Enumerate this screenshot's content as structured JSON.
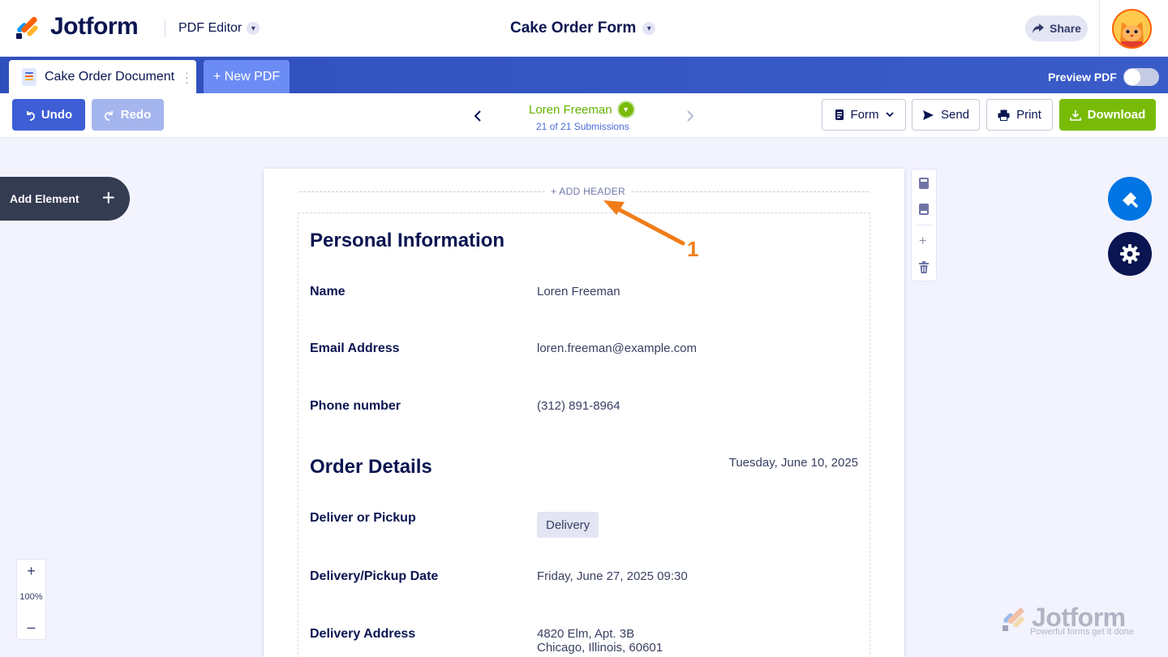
{
  "header": {
    "brand": "Jotform",
    "app_name": "PDF Editor",
    "form_title": "Cake Order Form",
    "share_label": "Share"
  },
  "tabs": {
    "document_tab": "Cake Order Document",
    "new_pdf": "+ New PDF",
    "preview_label": "Preview PDF"
  },
  "toolbar": {
    "undo": "Undo",
    "redo": "Redo",
    "submitter": "Loren Freeman",
    "submission_count": "21 of 21 Submissions",
    "form": "Form",
    "send": "Send",
    "print": "Print",
    "download": "Download"
  },
  "canvas": {
    "add_element": "Add Element",
    "add_header": "+ ADD HEADER",
    "zoom_level": "100%"
  },
  "document": {
    "personal_title": "Personal Information",
    "name_label": "Name",
    "name_value": "Loren Freeman",
    "email_label": "Email Address",
    "email_value": "loren.freeman@example.com",
    "phone_label": "Phone number",
    "phone_value": "(312) 891-8964",
    "order_title": "Order Details",
    "order_date": "Tuesday, June 10, 2025",
    "deliver_label": "Deliver or Pickup",
    "deliver_value": "Delivery",
    "date_label": "Delivery/Pickup Date",
    "date_value": "Friday, June 27, 2025 09:30",
    "address_label": "Delivery Address",
    "address_line1": "4820 Elm, Apt. 3B",
    "address_line2": "Chicago, Illinois, 60601"
  },
  "annotation": {
    "number": "1",
    "color": "#f07d1a"
  },
  "watermark": {
    "brand": "Jotform",
    "tagline": "Powerful forms get it done"
  },
  "colors": {
    "brand_blue": "#3e5ed6",
    "success_green": "#78bb07",
    "navy": "#0a1551"
  }
}
